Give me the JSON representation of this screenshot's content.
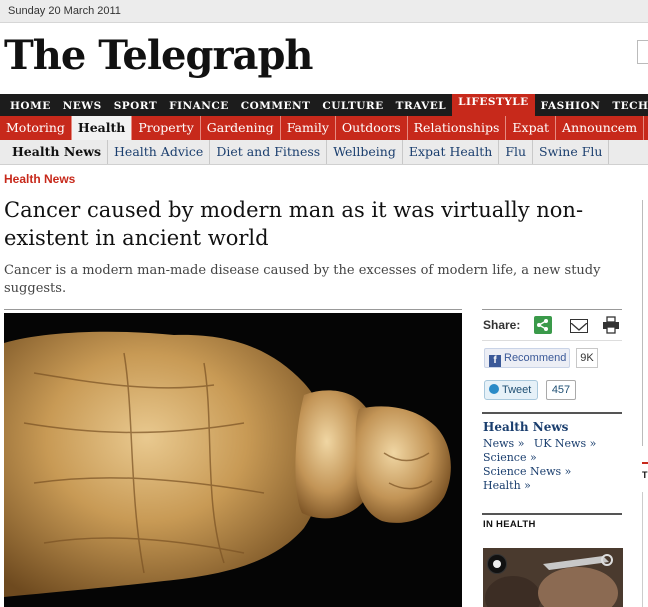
{
  "date": "Sunday 20 March 2011",
  "masthead": "The Telegraph",
  "nav_main": [
    "HOME",
    "NEWS",
    "SPORT",
    "FINANCE",
    "COMMENT",
    "CULTURE",
    "TRAVEL",
    "LIFESTYLE",
    "FASHION",
    "TECHN"
  ],
  "nav_main_active": "LIFESTYLE",
  "nav_sub": [
    "Motoring",
    "Health",
    "Property",
    "Gardening",
    "Family",
    "Outdoors",
    "Relationships",
    "Expat",
    "Announcem"
  ],
  "nav_sub_active": "Health",
  "nav_third": [
    "Health News",
    "Health Advice",
    "Diet and Fitness",
    "Wellbeing",
    "Expat Health",
    "Flu",
    "Swine Flu"
  ],
  "nav_third_active": "Health News",
  "article": {
    "section": "Health News",
    "headline": "Cancer caused by modern man as it was virtually non-existent in ancient world",
    "standfirst": "Cancer is a modern man-made disease caused by the excesses of modern life, a new study suggests."
  },
  "sidebar": {
    "share_label": "Share:",
    "recommend_label": "Recommend",
    "recommend_count": "9K",
    "tweet_label": "Tweet",
    "tweet_count": "457",
    "topic_title": "Health News",
    "topic_links": [
      "News »",
      "UK News »",
      "Science »",
      "Science News »",
      "Health »"
    ],
    "in_health_label": "IN HEALTH"
  },
  "right_edge_letter": "T",
  "icons": [
    "share-icon",
    "email-icon",
    "print-icon",
    "facebook-icon",
    "twitter-icon",
    "camera-icon"
  ],
  "colors": {
    "brand_red": "#c7291b",
    "nav_dark": "#1c1c1c",
    "link_blue": "#1a3e6e"
  }
}
